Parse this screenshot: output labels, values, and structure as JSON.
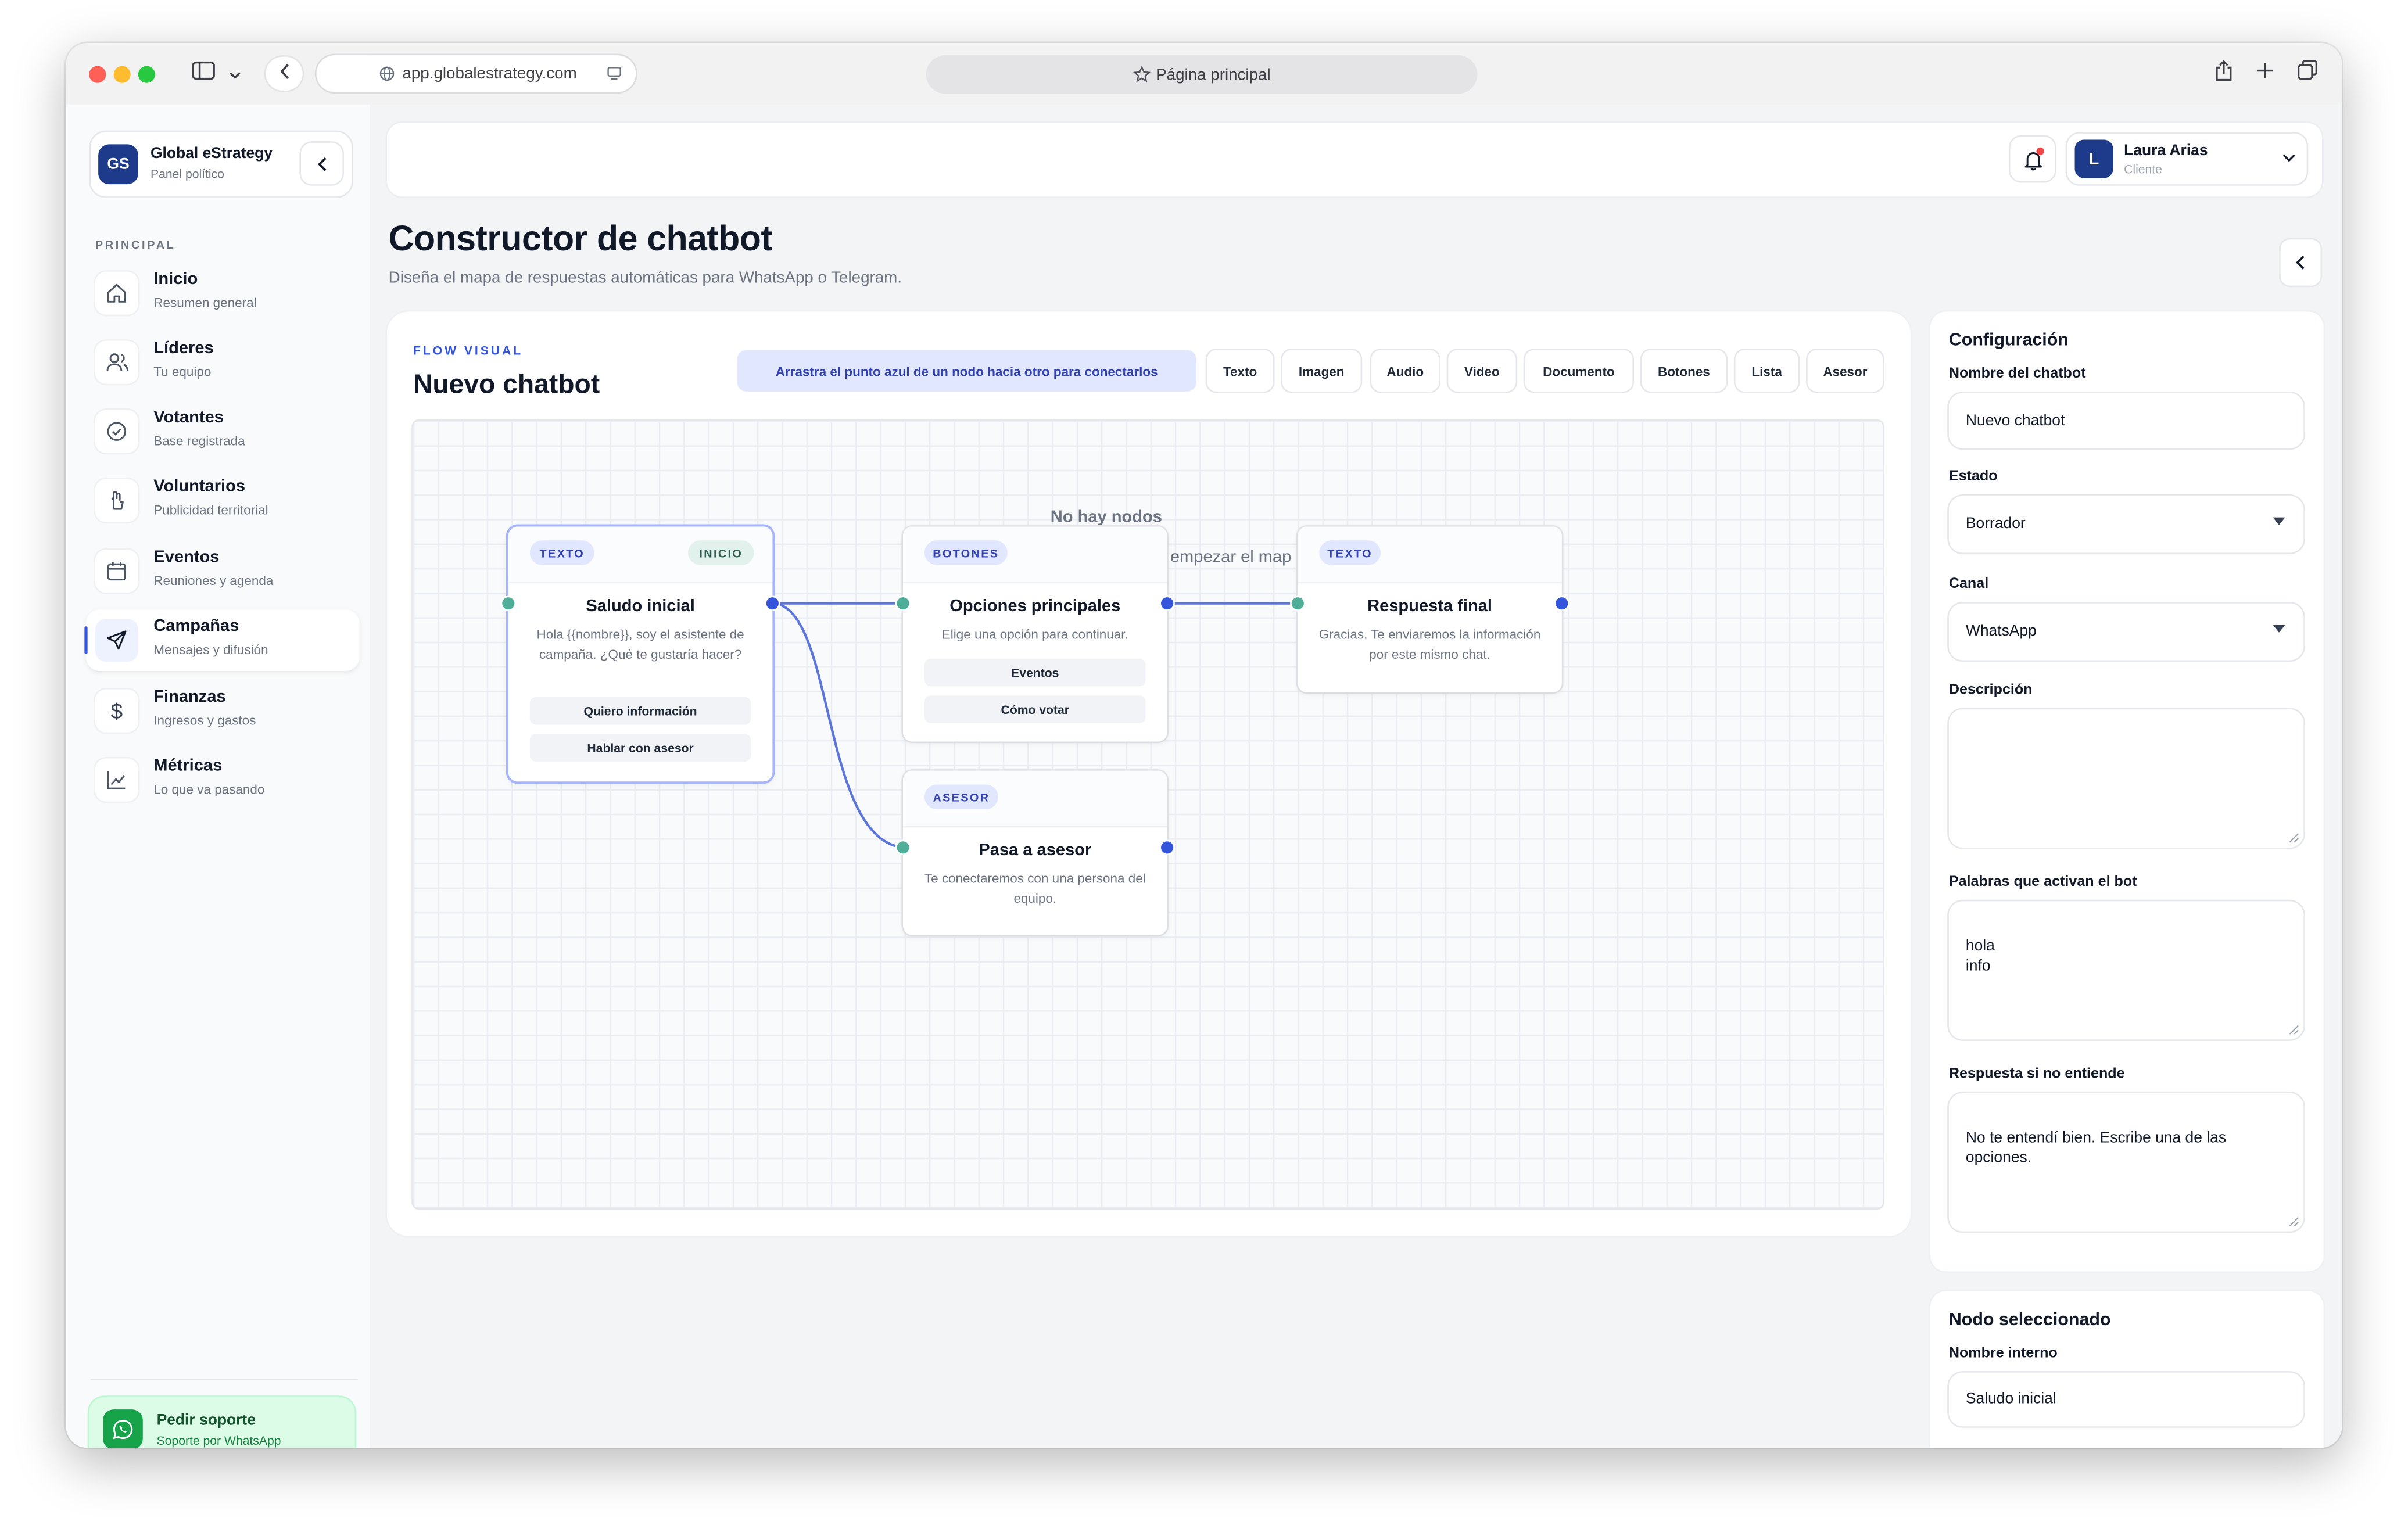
{
  "browser": {
    "url": "app.globalestrategy.com",
    "tab_title": "Página principal"
  },
  "brand": {
    "initials": "GS",
    "name": "Global eStrategy",
    "subtitle": "Panel político"
  },
  "sidebar": {
    "section_label": "PRINCIPAL",
    "items": [
      {
        "label": "Inicio",
        "sub": "Resumen general",
        "icon": "home-icon"
      },
      {
        "label": "Líderes",
        "sub": "Tu equipo",
        "icon": "users-icon"
      },
      {
        "label": "Votantes",
        "sub": "Base registrada",
        "icon": "check-circle-icon"
      },
      {
        "label": "Voluntarios",
        "sub": "Publicidad territorial",
        "icon": "hand-icon"
      },
      {
        "label": "Eventos",
        "sub": "Reuniones y agenda",
        "icon": "calendar-icon"
      },
      {
        "label": "Campañas",
        "sub": "Mensajes y difusión",
        "icon": "send-icon",
        "active": true
      },
      {
        "label": "Finanzas",
        "sub": "Ingresos y gastos",
        "icon": "dollar-icon"
      },
      {
        "label": "Métricas",
        "sub": "Lo que va pasando",
        "icon": "chart-line-icon"
      }
    ],
    "support": {
      "title": "Pedir soporte",
      "sub": "Soporte por WhatsApp"
    }
  },
  "user": {
    "initial": "L",
    "name": "Laura Arias",
    "role": "Cliente"
  },
  "page": {
    "title": "Constructor de chatbot",
    "subtitle": "Diseña el mapa de respuestas automáticas para WhatsApp o Telegram."
  },
  "flow": {
    "eyebrow": "FLOW VISUAL",
    "title": "Nuevo chatbot",
    "hint": "Arrastra el punto azul de un nodo hacia otro para conectarlos",
    "node_types": [
      "Texto",
      "Imagen",
      "Audio",
      "Video",
      "Documento",
      "Botones",
      "Lista",
      "Asesor"
    ],
    "empty_line1": "No hay nodos",
    "empty_line2": "empezar el map"
  },
  "nodes": {
    "n1": {
      "type": "TEXTO",
      "badge": "INICIO",
      "title": "Saludo inicial",
      "text": "Hola {{nombre}}, soy el asistente de campaña. ¿Qué te gustaría hacer?",
      "buttons": [
        "Quiero información",
        "Hablar con asesor"
      ]
    },
    "n2": {
      "type": "BOTONES",
      "title": "Opciones principales",
      "text": "Elige una opción para continuar.",
      "buttons": [
        "Eventos",
        "Cómo votar"
      ]
    },
    "n3": {
      "type": "TEXTO",
      "title": "Respuesta final",
      "text": "Gracias. Te enviaremos la información por este mismo chat."
    },
    "n4": {
      "type": "ASESOR",
      "title": "Pasa a asesor",
      "text": "Te conectaremos con una persona del equipo."
    }
  },
  "config": {
    "heading": "Configuración",
    "name_label": "Nombre del chatbot",
    "name_value": "Nuevo chatbot",
    "state_label": "Estado",
    "state_value": "Borrador",
    "channel_label": "Canal",
    "channel_value": "WhatsApp",
    "desc_label": "Descripción",
    "desc_value": "",
    "keywords_label": "Palabras que activan el bot",
    "keywords_value": "hola\ninfo",
    "fallback_label": "Respuesta si no entiende",
    "fallback_value": "No te entendí bien. Escribe una de las opciones."
  },
  "selected_node": {
    "heading": "Nodo seleccionado",
    "internal_label": "Nombre interno",
    "internal_value": "Saludo inicial"
  },
  "colors": {
    "accent": "#3455db",
    "port_in": "#4fae97",
    "brand_dark": "#1e3a8a",
    "support_green": "#dcfce7"
  }
}
